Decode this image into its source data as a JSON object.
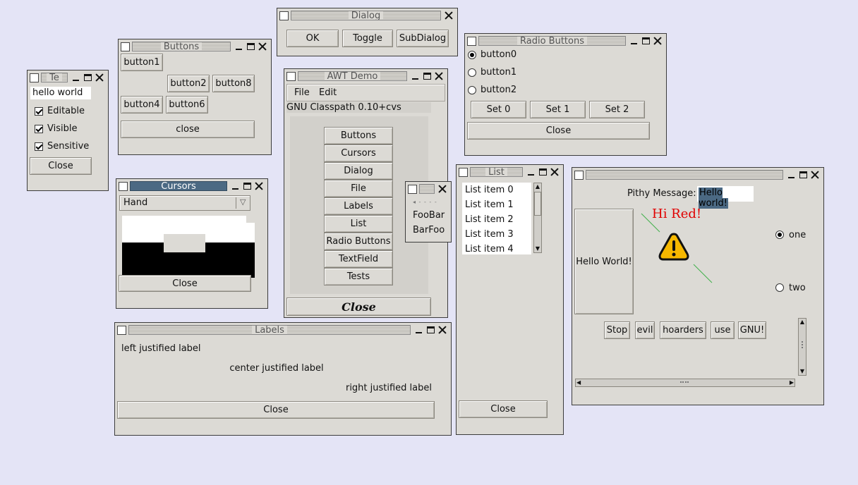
{
  "text_window": {
    "title": "Te",
    "field_value": "hello world",
    "checkboxes": [
      {
        "label": "Editable",
        "checked": true
      },
      {
        "label": "Visible",
        "checked": true
      },
      {
        "label": "Sensitive",
        "checked": true
      }
    ],
    "close_label": "Close"
  },
  "buttons_window": {
    "title": "Buttons",
    "buttons": [
      "button1",
      "button2",
      "button8",
      "button4",
      "button6"
    ],
    "close_label": "close"
  },
  "dialog_window": {
    "title": "Dialog",
    "buttons": [
      "OK",
      "Toggle",
      "SubDialog"
    ]
  },
  "radio_window": {
    "title": "Radio Buttons",
    "options": [
      {
        "label": "button0",
        "selected": true
      },
      {
        "label": "button1",
        "selected": false
      },
      {
        "label": "button2",
        "selected": false
      }
    ],
    "set_buttons": [
      "Set 0",
      "Set 1",
      "Set 2"
    ],
    "close_label": "Close"
  },
  "awt_demo_window": {
    "title": "AWT Demo",
    "menu": [
      "File",
      "Edit"
    ],
    "version": "GNU Classpath 0.10+cvs",
    "demo_buttons": [
      "Buttons",
      "Cursors",
      "Dialog",
      "File",
      "Labels",
      "List",
      "Radio Buttons",
      "TextField",
      "Tests"
    ],
    "close_label": "Close"
  },
  "cursors_window": {
    "title": "Cursors",
    "selected_cursor": "Hand",
    "close_label": "Close"
  },
  "popup_window": {
    "items": [
      "FooBar",
      "BarFoo"
    ]
  },
  "list_window": {
    "title": "List",
    "items": [
      "List item 0",
      "List item 1",
      "List item 2",
      "List item 3",
      "List item 4"
    ],
    "close_label": "Close"
  },
  "labels_window": {
    "title": "Labels",
    "left": "left justified label",
    "center": "center justified label",
    "right": "right justified label",
    "close_label": "Close"
  },
  "tests_window": {
    "pithy_label": "Pithy Message:",
    "pithy_value": "Hello world!",
    "hello_button": "Hello World!",
    "hi_red": "Hi Red!",
    "hi_red_color": "#e00000",
    "radios": [
      {
        "label": "one",
        "selected": true
      },
      {
        "label": "two",
        "selected": false
      }
    ],
    "buttons": [
      "Stop",
      "evil",
      "hoarders",
      "use",
      "GNU!"
    ],
    "warning_icon": "warning-icon"
  }
}
